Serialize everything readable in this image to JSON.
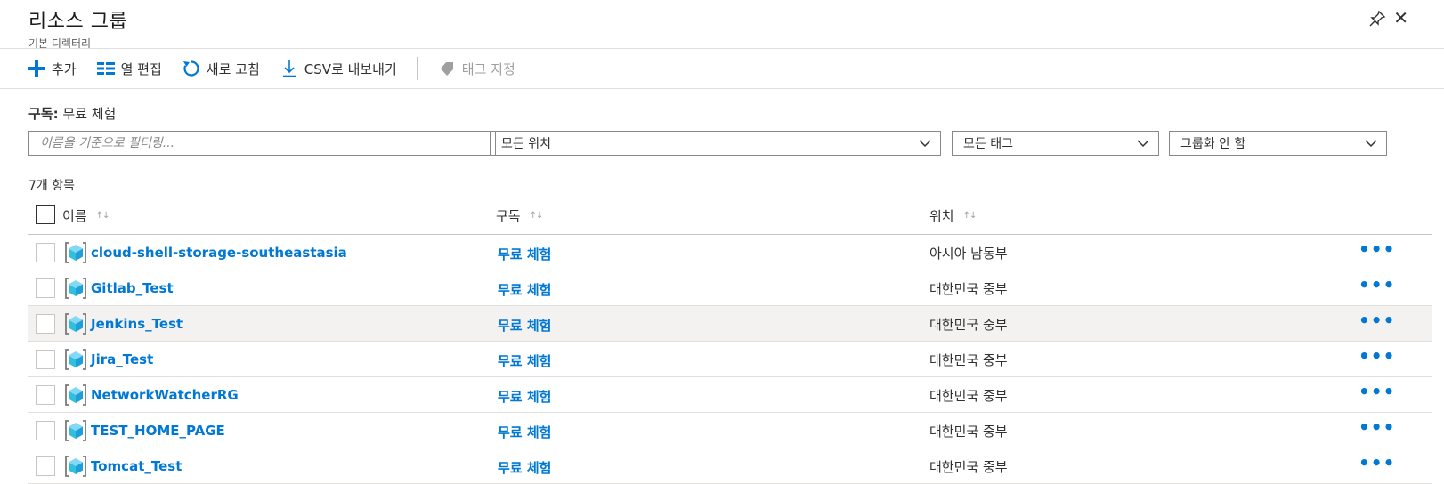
{
  "header": {
    "title": "리소스 그룹",
    "subtitle": "기본 디렉터리"
  },
  "toolbar": {
    "add_label": "추가",
    "edit_columns_label": "열 편집",
    "refresh_label": "새로 고침",
    "export_csv_label": "CSV로 내보내기",
    "assign_tags_label": "태그 지정"
  },
  "subscription": {
    "label": "구독:",
    "value": "무료 체험"
  },
  "filters": {
    "name_placeholder": "이름을 기준으로 필터링...",
    "location_value": "모든 위치",
    "tags_value": "모든 태그",
    "grouping_value": "그룹화 안 함"
  },
  "list": {
    "count_label": "7개 항목",
    "columns": {
      "name": "이름",
      "subscription": "구독",
      "location": "위치"
    },
    "sort_glyph": "↑↓",
    "more_glyph": "•••",
    "rows": [
      {
        "name": "cloud-shell-storage-southeastasia",
        "subscription": "무료 체험",
        "location": "아시아 남동부"
      },
      {
        "name": "Gitlab_Test",
        "subscription": "무료 체험",
        "location": "대한민국 중부"
      },
      {
        "name": "Jenkins_Test",
        "subscription": "무료 체험",
        "location": "대한민국 중부"
      },
      {
        "name": "Jira_Test",
        "subscription": "무료 체험",
        "location": "대한민국 중부"
      },
      {
        "name": "NetworkWatcherRG",
        "subscription": "무료 체험",
        "location": "대한민국 중부"
      },
      {
        "name": "TEST_HOME_PAGE",
        "subscription": "무료 체험",
        "location": "대한민국 중부"
      },
      {
        "name": "Tomcat_Test",
        "subscription": "무료 체험",
        "location": "대한민국 중부"
      }
    ]
  },
  "colors": {
    "accent": "#0078d4",
    "hover_row": "#f3f2f1"
  }
}
